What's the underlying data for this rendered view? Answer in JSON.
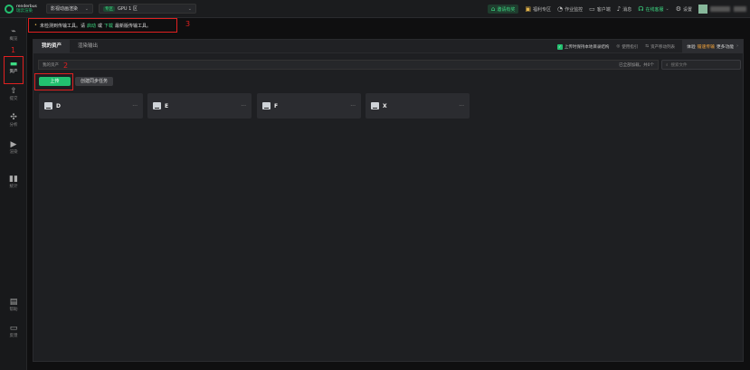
{
  "topbar": {
    "logo_line1": "renderbus",
    "logo_line2": "瑞云渲染",
    "project_select": "影视动画渲染",
    "gpu_badge": "专区",
    "gpu_select": "GPU 1 区",
    "invite": "邀请有奖",
    "welfare": "福利专区",
    "monitor": "作业监控",
    "client": "客户端",
    "message": "消息",
    "service": "在线客服",
    "settings": "设置"
  },
  "sidebar": {
    "items": [
      {
        "label": "概览",
        "icon": "chart-line-icon"
      },
      {
        "label": "资产",
        "icon": "folder-icon"
      },
      {
        "label": "提交",
        "icon": "upload-icon"
      },
      {
        "label": "分析",
        "icon": "analysis-icon"
      },
      {
        "label": "渲染",
        "icon": "render-icon"
      },
      {
        "label": "统计",
        "icon": "bar-chart-icon"
      },
      {
        "label": "帮助",
        "icon": "help-doc-icon"
      },
      {
        "label": "反馈",
        "icon": "feedback-icon"
      }
    ]
  },
  "notice": {
    "text1": "未检测到传输工具。请",
    "start": "启动",
    "or": "或",
    "download": "下载",
    "text2": "最新版传输工具。"
  },
  "annotations": {
    "n1": "1",
    "n2": "2",
    "n3": "3"
  },
  "tabs": [
    {
      "label": "我的资产"
    },
    {
      "label": "渲染输出"
    }
  ],
  "tab_right": {
    "keep_structure": "上传时保持本地目录结构",
    "guide": "使用指引",
    "move_list": "资产移动列表",
    "experience": "体验",
    "fast": "镭速传输",
    "more": "更多功能"
  },
  "pathbar": {
    "path": "我的资产",
    "info": "已全部加载，共0个"
  },
  "search": {
    "placeholder": "搜索文件"
  },
  "buttons": {
    "upload": "上传",
    "sync": "创建同步任务"
  },
  "drives": [
    {
      "label": "D"
    },
    {
      "label": "E"
    },
    {
      "label": "F"
    },
    {
      "label": "X"
    }
  ],
  "colors": {
    "accent": "#22c06f",
    "annotation": "#e02020",
    "highlight": "#f2a33a"
  }
}
